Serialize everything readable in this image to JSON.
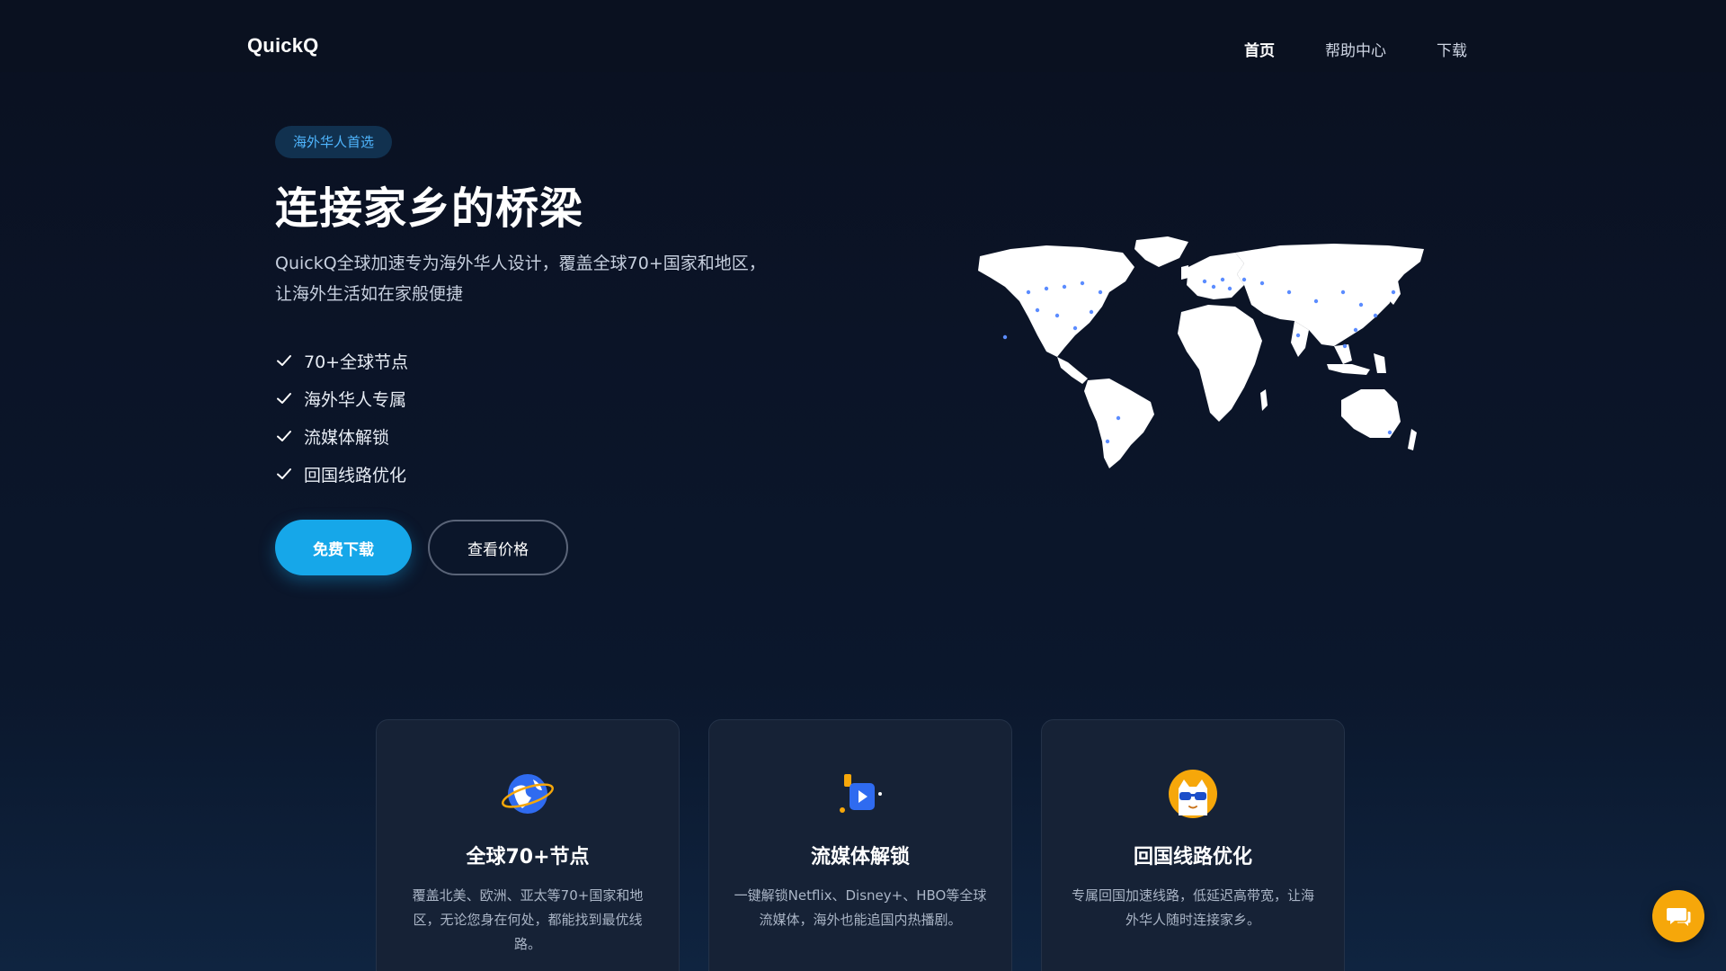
{
  "header": {
    "logo": "QuickQ",
    "nav": [
      {
        "label": "首页",
        "active": true
      },
      {
        "label": "帮助中心",
        "active": false
      },
      {
        "label": "下载",
        "active": false
      }
    ]
  },
  "hero": {
    "badge": "海外华人首选",
    "title": "连接家乡的桥梁",
    "description_line1": "QuickQ全球加速专为海外华人设计，覆盖全球70+国家和地区，",
    "description_line2": "让海外生活如在家般便捷",
    "features": [
      "70+全球节点",
      "海外华人专属",
      "流媒体解锁",
      "回国线路优化"
    ],
    "primary_button": "免费下载",
    "secondary_button": "查看价格"
  },
  "cards": [
    {
      "icon": "globe-orbit-icon",
      "title": "全球70+节点",
      "text": "覆盖北美、欧洲、亚太等70+国家和地区，无论您身在何处，都能找到最优线路。"
    },
    {
      "icon": "video-play-icon",
      "title": "流媒体解锁",
      "text": "一键解锁Netflix、Disney+、HBO等全球流媒体，海外也能追国内热播剧。"
    },
    {
      "icon": "cat-sunglasses-icon",
      "title": "回国线路优化",
      "text": "专属回国加速线路，低延迟高带宽，让海外华人随时连接家乡。"
    }
  ],
  "colors": {
    "accent": "#16a7e9",
    "badge_text": "#4fb6ff",
    "chat": "#f6a70a"
  }
}
